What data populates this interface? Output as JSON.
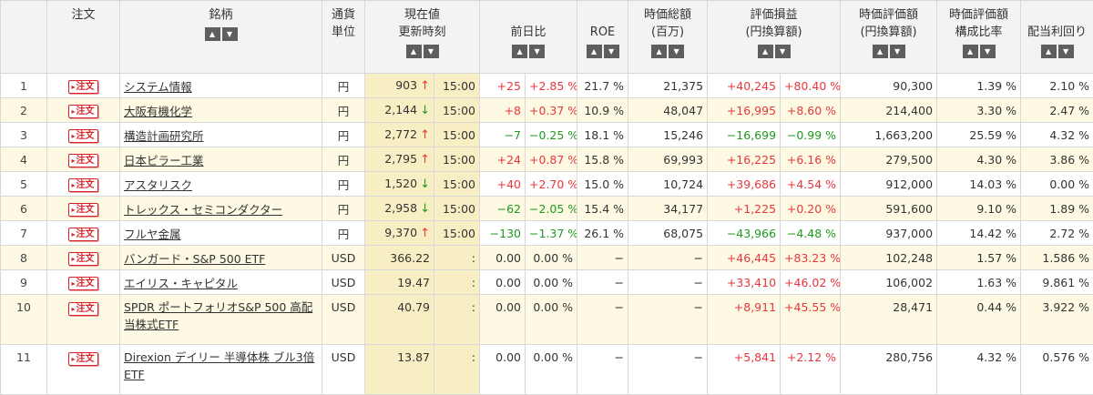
{
  "headers": {
    "order": "注文",
    "name": "銘柄",
    "currency": [
      "通貨",
      "単位"
    ],
    "price": [
      "現在値",
      "更新時刻"
    ],
    "change": "前日比",
    "roe": "ROE",
    "mcap": [
      "時価総額",
      "(百万)"
    ],
    "pl": [
      "評価損益",
      "(円換算額)"
    ],
    "mv": [
      "時価評価額",
      "(円換算額)"
    ],
    "ratio": [
      "時価評価額",
      "構成比率"
    ],
    "yield": "配当利回り"
  },
  "order_label": "注文",
  "rows": [
    {
      "no": "1",
      "name": "システム情報",
      "cur": "円",
      "price": "903",
      "dir": "up",
      "time": "15:00",
      "chg": "+25",
      "chgp": "+2.85 %",
      "sign": "plus",
      "roe": "21.7 %",
      "mcap": "21,375",
      "pl": "+40,245",
      "plp": "+80.40 %",
      "plsign": "plus",
      "mv": "90,300",
      "ratio": "1.39 %",
      "yield": "2.10 %"
    },
    {
      "no": "2",
      "name": "大阪有機化学",
      "cur": "円",
      "price": "2,144",
      "dir": "down",
      "time": "15:00",
      "chg": "+8",
      "chgp": "+0.37 %",
      "sign": "plus",
      "roe": "10.9 %",
      "mcap": "48,047",
      "pl": "+16,995",
      "plp": "+8.60 %",
      "plsign": "plus",
      "mv": "214,400",
      "ratio": "3.30 %",
      "yield": "2.47 %"
    },
    {
      "no": "3",
      "name": "構造計画研究所",
      "cur": "円",
      "price": "2,772",
      "dir": "up",
      "time": "15:00",
      "chg": "−7",
      "chgp": "−0.25 %",
      "sign": "minus",
      "roe": "18.1 %",
      "mcap": "15,246",
      "pl": "−16,699",
      "plp": "−0.99 %",
      "plsign": "minus",
      "mv": "1,663,200",
      "ratio": "25.59 %",
      "yield": "4.32 %"
    },
    {
      "no": "4",
      "name": "日本ピラー工業",
      "cur": "円",
      "price": "2,795",
      "dir": "up",
      "time": "15:00",
      "chg": "+24",
      "chgp": "+0.87 %",
      "sign": "plus",
      "roe": "15.8 %",
      "mcap": "69,993",
      "pl": "+16,225",
      "plp": "+6.16 %",
      "plsign": "plus",
      "mv": "279,500",
      "ratio": "4.30 %",
      "yield": "3.86 %"
    },
    {
      "no": "5",
      "name": "アスタリスク",
      "cur": "円",
      "price": "1,520",
      "dir": "down",
      "time": "15:00",
      "chg": "+40",
      "chgp": "+2.70 %",
      "sign": "plus",
      "roe": "15.0 %",
      "mcap": "10,724",
      "pl": "+39,686",
      "plp": "+4.54 %",
      "plsign": "plus",
      "mv": "912,000",
      "ratio": "14.03 %",
      "yield": "0.00 %"
    },
    {
      "no": "6",
      "name": "トレックス・セミコンダクター",
      "cur": "円",
      "price": "2,958",
      "dir": "down",
      "time": "15:00",
      "chg": "−62",
      "chgp": "−2.05 %",
      "sign": "minus",
      "roe": "15.4 %",
      "mcap": "34,177",
      "pl": "+1,225",
      "plp": "+0.20 %",
      "plsign": "plus",
      "mv": "591,600",
      "ratio": "9.10 %",
      "yield": "1.89 %"
    },
    {
      "no": "7",
      "name": "フルヤ金属",
      "cur": "円",
      "price": "9,370",
      "dir": "up",
      "time": "15:00",
      "chg": "−130",
      "chgp": "−1.37 %",
      "sign": "minus",
      "roe": "26.1 %",
      "mcap": "68,075",
      "pl": "−43,966",
      "plp": "−4.48 %",
      "plsign": "minus",
      "mv": "937,000",
      "ratio": "14.42 %",
      "yield": "2.72 %"
    },
    {
      "no": "8",
      "name": "バンガード・S&P 500 ETF",
      "cur": "USD",
      "price": "366.22",
      "dir": "",
      "time": ":",
      "chg": "0.00",
      "chgp": "0.00 %",
      "sign": "",
      "roe": "−",
      "mcap": "−",
      "pl": "+46,445",
      "plp": "+83.23 %",
      "plsign": "plus",
      "mv": "102,248",
      "ratio": "1.57 %",
      "yield": "1.586 %"
    },
    {
      "no": "9",
      "name": "エイリス・キャピタル",
      "cur": "USD",
      "price": "19.47",
      "dir": "",
      "time": ":",
      "chg": "0.00",
      "chgp": "0.00 %",
      "sign": "",
      "roe": "−",
      "mcap": "−",
      "pl": "+33,410",
      "plp": "+46.02 %",
      "plsign": "plus",
      "mv": "106,002",
      "ratio": "1.63 %",
      "yield": "9.861 %"
    },
    {
      "no": "10",
      "name": "SPDR ポートフォリオS&P 500 高配当株式ETF",
      "cur": "USD",
      "price": "40.79",
      "dir": "",
      "time": ":",
      "chg": "0.00",
      "chgp": "0.00 %",
      "sign": "",
      "roe": "−",
      "mcap": "−",
      "pl": "+8,911",
      "plp": "+45.55 %",
      "plsign": "plus",
      "mv": "28,471",
      "ratio": "0.44 %",
      "yield": "3.922 %",
      "tall": true
    },
    {
      "no": "11",
      "name": "Direxion デイリー 半導体株 ブル3倍 ETF",
      "cur": "USD",
      "price": "13.87",
      "dir": "",
      "time": ":",
      "chg": "0.00",
      "chgp": "0.00 %",
      "sign": "",
      "roe": "−",
      "mcap": "−",
      "pl": "+5,841",
      "plp": "+2.12 %",
      "plsign": "plus",
      "mv": "280,756",
      "ratio": "4.32 %",
      "yield": "0.576 %",
      "tall": true
    }
  ],
  "arrows": {
    "up": "↑",
    "down": "↓"
  }
}
